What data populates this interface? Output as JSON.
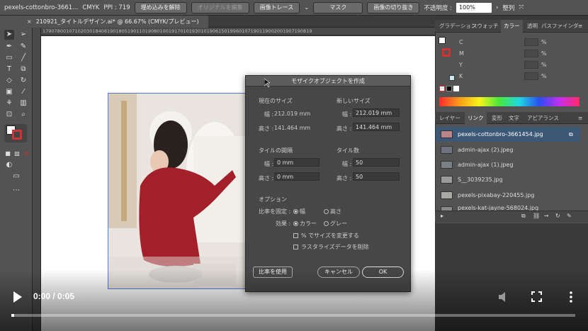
{
  "control_bar": {
    "doc_name": "pexels-cottonbro-3661...",
    "color_mode": "CMYK",
    "ppi": "PPI : 719",
    "embed_btn": "埋め込みを解除",
    "edit_original_btn": "オリジナルを編集",
    "image_trace_btn": "画像トレース",
    "mask_btn": "マスク",
    "crop_btn": "画像の切り抜き",
    "opacity_label": "不透明度 :",
    "opacity_value": "100%",
    "arrange_btn": "整列"
  },
  "doc_tab": {
    "close": "×",
    "title": "210921_タイトルデザイン.ai* @ 66.67% (CMYK/プレビュー)"
  },
  "ruler_text": "17907800107102030184081901805190110190801001917010193010190615019960107190119002001907190819",
  "dialog": {
    "title": "モザイクオブジェクトを作成",
    "current_size": "現在のサイズ",
    "new_size": "新しいサイズ",
    "width_label": "幅 :",
    "height_label": "高さ :",
    "cur_width": "212.019 mm",
    "cur_height": "141.464 mm",
    "new_width": "212.019 mm",
    "new_height": "141.464 mm",
    "tile_spacing": "タイルの間隔",
    "tile_count": "タイル数",
    "sp_width": "0 mm",
    "sp_height": "0 mm",
    "cnt_width": "50",
    "cnt_height": "50",
    "options": "オプション",
    "constrain_label": "比率を固定 :",
    "constrain_width": "幅",
    "constrain_height": "高さ",
    "effect_label": "効果 :",
    "effect_color": "カラー",
    "effect_gray": "グレー",
    "resize_pct": "% でサイズを変更する",
    "delete_raster": "ラスタライズデータを削除",
    "use_ratio_btn": "比率を使用",
    "cancel_btn": "キャンセル",
    "ok_btn": "OK"
  },
  "color_panel": {
    "tabs": [
      "グラデーション",
      "スウォッチ",
      "カラー",
      "透明",
      "パスファインダ"
    ],
    "channels": [
      "C",
      "M",
      "Y",
      "K"
    ],
    "pct": "%"
  },
  "links_panel": {
    "tabs": [
      "レイヤー",
      "リンク",
      "変形",
      "文字",
      "アピアランス"
    ],
    "items": [
      {
        "name": "pexels-cottonbro-3661454.jpg"
      },
      {
        "name": "admin-ajax (2).jpeg"
      },
      {
        "name": "admin-ajax (1).jpeg"
      },
      {
        "name": "S__3039235.jpg"
      },
      {
        "name": "pexels-pixabay-220455.jpg"
      },
      {
        "name": "pexels-kat-jayne-568024.jpg"
      }
    ]
  },
  "video": {
    "time": "0:00 / 0:05",
    "progress": 0.005
  },
  "colors": {
    "accent": "#3d5877",
    "dialog_bg": "#474747",
    "panel_bg": "#535353"
  }
}
